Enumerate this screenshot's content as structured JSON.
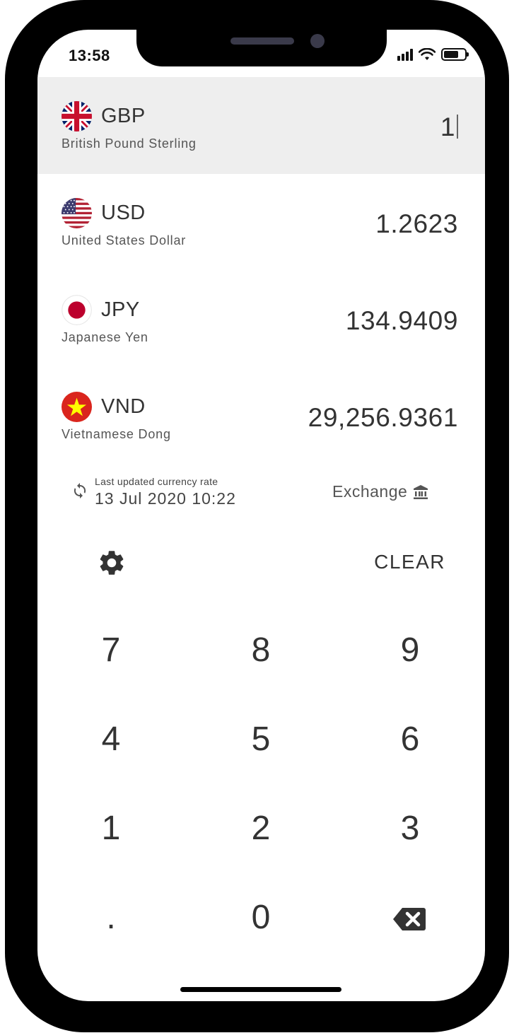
{
  "status": {
    "time": "13:58"
  },
  "base": {
    "code": "GBP",
    "name": "British Pound Sterling",
    "value": "1"
  },
  "conversions": [
    {
      "code": "USD",
      "name": "United States Dollar",
      "value": "1.2623"
    },
    {
      "code": "JPY",
      "name": "Japanese Yen",
      "value": "134.9409"
    },
    {
      "code": "VND",
      "name": "Vietnamese Dong",
      "value": "29,256.9361"
    }
  ],
  "rate_info": {
    "label": "Last updated currency rate",
    "date": "13 Jul 2020 10:22"
  },
  "exchange": {
    "label": "Exchange"
  },
  "keypad": {
    "clear_label": "CLEAR",
    "keys": [
      "7",
      "8",
      "9",
      "4",
      "5",
      "6",
      "1",
      "2",
      "3",
      ".",
      "0"
    ]
  },
  "colors": {
    "active_row_bg": "#eeeeee",
    "text": "#333333",
    "vn_red": "#da251d",
    "vn_star": "#ffff00",
    "jp_red": "#bc002d"
  },
  "icons": [
    "refresh-icon",
    "bank-icon",
    "settings-icon",
    "backspace-icon"
  ]
}
